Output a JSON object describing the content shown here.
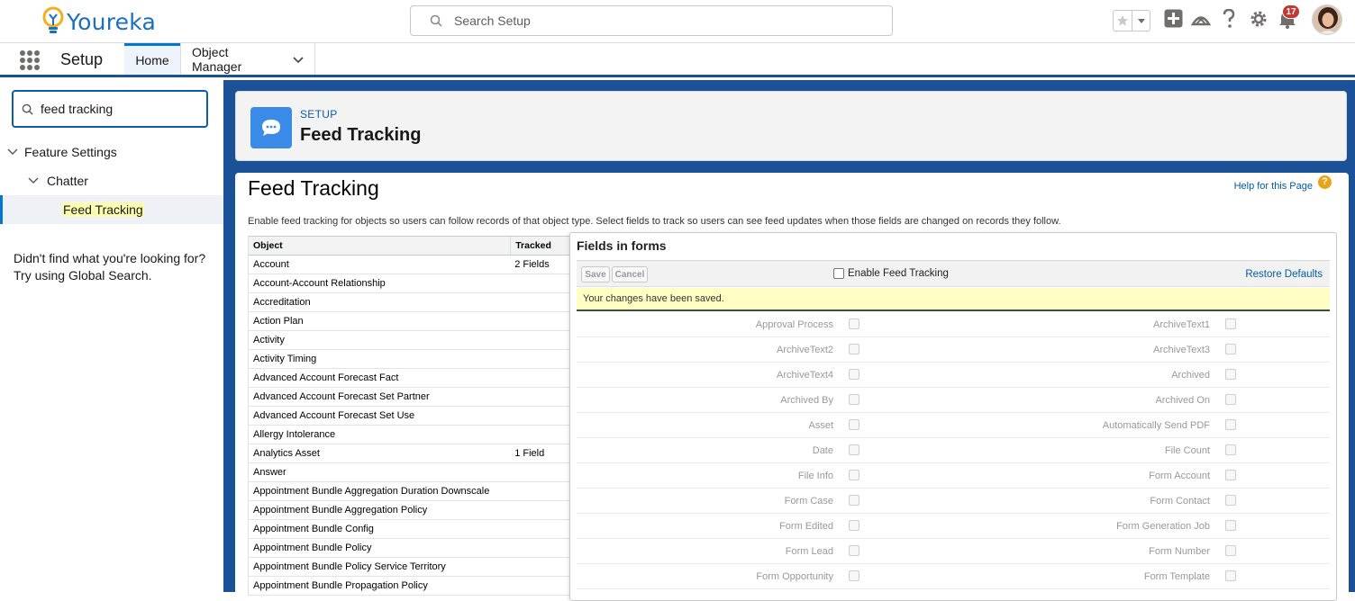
{
  "header": {
    "brand": "Youreka",
    "search_placeholder": "Search Setup",
    "notification_count": "17"
  },
  "context_bar": {
    "app_name": "Setup",
    "tabs": [
      {
        "label": "Home"
      },
      {
        "label": "Object Manager"
      }
    ]
  },
  "sidebar": {
    "quickfind_value": "feed tracking",
    "tree": [
      {
        "label": "Feature Settings"
      },
      {
        "label": "Chatter"
      },
      {
        "label": "Feed Tracking"
      }
    ],
    "not_found_line1": "Didn't find what you're looking for?",
    "not_found_line2": "Try using Global Search."
  },
  "page_header": {
    "eyebrow": "SETUP",
    "title": "Feed Tracking"
  },
  "content": {
    "title": "Feed Tracking",
    "help_link": "Help for this Page",
    "help_icon_glyph": "?",
    "description": "Enable feed tracking for objects so users can follow records of that object type. Select fields to track so users can see feed updates when those fields are changed on records they follow."
  },
  "object_table": {
    "headers": [
      "Object",
      "Tracked"
    ],
    "rows": [
      [
        "Account",
        "2 Fields"
      ],
      [
        "Account-Account Relationship",
        ""
      ],
      [
        "Accreditation",
        ""
      ],
      [
        "Action Plan",
        ""
      ],
      [
        "Activity",
        ""
      ],
      [
        "Activity Timing",
        ""
      ],
      [
        "Advanced Account Forecast Fact",
        ""
      ],
      [
        "Advanced Account Forecast Set Partner",
        ""
      ],
      [
        "Advanced Account Forecast Set Use",
        ""
      ],
      [
        "Allergy Intolerance",
        ""
      ],
      [
        "Analytics Asset",
        "1 Field"
      ],
      [
        "Answer",
        ""
      ],
      [
        "Appointment Bundle Aggregation Duration Downscale",
        ""
      ],
      [
        "Appointment Bundle Aggregation Policy",
        ""
      ],
      [
        "Appointment Bundle Config",
        ""
      ],
      [
        "Appointment Bundle Policy",
        ""
      ],
      [
        "Appointment Bundle Policy Service Territory",
        ""
      ],
      [
        "Appointment Bundle Propagation Policy",
        ""
      ]
    ]
  },
  "fields_panel": {
    "title": "Fields in forms",
    "save_label": "Save",
    "cancel_label": "Cancel",
    "enable_label": "Enable Feed Tracking",
    "restore_label": "Restore Defaults",
    "saved_message": "Your changes have been saved.",
    "rows": [
      [
        "Approval Process",
        "ArchiveText1"
      ],
      [
        "ArchiveText2",
        "ArchiveText3"
      ],
      [
        "ArchiveText4",
        "Archived"
      ],
      [
        "Archived By",
        "Archived On"
      ],
      [
        "Asset",
        "Automatically Send PDF"
      ],
      [
        "Date",
        "File Count"
      ],
      [
        "File Info",
        "Form Account"
      ],
      [
        "Form Case",
        "Form Contact"
      ],
      [
        "Form Edited",
        "Form Generation Job"
      ],
      [
        "Form Lead",
        "Form Number"
      ],
      [
        "Form Opportunity",
        "Form Template"
      ]
    ]
  },
  "colors": {
    "brand_blue": "#1b5297",
    "link": "#015ba7",
    "badge_red": "#c23934",
    "saved_yellow": "#ffffc4"
  }
}
